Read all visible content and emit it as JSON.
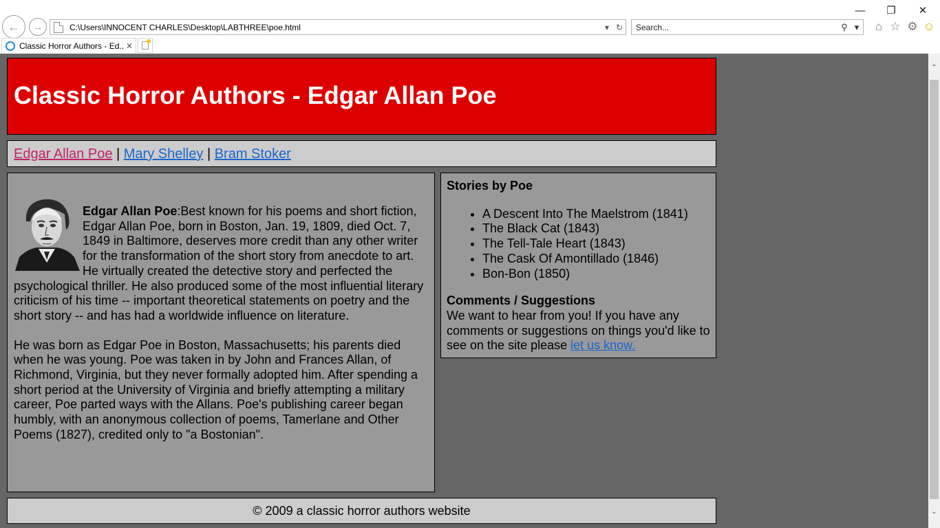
{
  "browser": {
    "address": "C:\\Users\\INNOCENT CHARLES\\Desktop\\LABTHREE\\poe.html",
    "search_placeholder": "Search...",
    "tab_title": "Classic Horror Authors - Ed...",
    "icons": {
      "back": "back-arrow-icon",
      "forward": "forward-arrow-icon",
      "home": "home-icon",
      "favorites": "star-icon",
      "tools": "gear-icon",
      "feedback": "smiley-icon"
    }
  },
  "page": {
    "title": "Classic Horror Authors - Edgar Allan Poe",
    "nav": {
      "poe": "Edgar Allan Poe",
      "separator": "|",
      "shelley": "Mary Shelley",
      "stoker": "Bram Stoker"
    },
    "bio": {
      "name": "Edgar Allan Poe",
      "intro": ":Best known for his poems and short fiction, Edgar Allan Poe, born in Boston, Jan. 19, 1809, died Oct. 7, 1849 in Baltimore, deserves more credit than any other writer for the transformation of the short story from anecdote to art. He virtually created the detective story and perfected the psychological thriller. He also produced some of the most influential literary criticism of his time -- important theoretical statements on poetry and the short story -- and has had a worldwide influence on literature.",
      "second": "He was born as Edgar Poe in Boston, Massachusetts; his parents died when he was young. Poe was taken in by John and Frances Allan, of Richmond, Virginia, but they never formally adopted him. After spending a short period at the University of Virginia and briefly attempting a military career, Poe parted ways with the Allans. Poe's publishing career began humbly, with an anonymous collection of poems, Tamerlane and Other Poems (1827), credited only to \"a Bostonian\"."
    },
    "stories": {
      "heading": "Stories by Poe",
      "items": [
        "A Descent Into The Maelstrom (1841)",
        "The Black Cat (1843)",
        "The Tell-Tale Heart (1843)",
        "The Cask Of Amontillado (1846)",
        "Bon-Bon (1850)"
      ]
    },
    "comments": {
      "heading": "Comments / Suggestions",
      "text": "We want to hear from you! If you have any comments or suggestions on things you'd like to see on the site please ",
      "link": "let us know."
    },
    "footer": "© 2009 a classic horror authors website"
  },
  "colors": {
    "header_bg": "#dd0000",
    "page_bg": "#666666",
    "panel_bg": "#999999",
    "nav_bg": "#cccccc",
    "link": "#1a66cc",
    "visited_link": "#c0246a"
  }
}
